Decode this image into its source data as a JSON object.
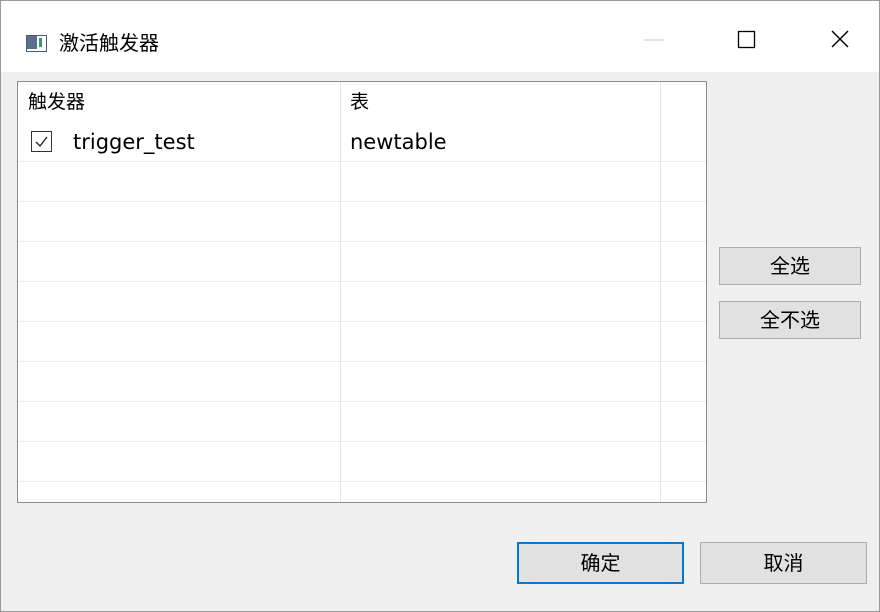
{
  "window": {
    "title": "激活触发器",
    "icons": {
      "app": "app-window-icon",
      "minimize": "minimize-icon",
      "maximize": "maximize-icon",
      "close": "close-icon"
    }
  },
  "table": {
    "columns": [
      "触发器",
      "表"
    ],
    "rows": [
      {
        "checked": true,
        "trigger": "trigger_test",
        "table": "newtable"
      }
    ]
  },
  "side_buttons": {
    "select_all": "全选",
    "select_none": "全不选"
  },
  "footer": {
    "ok": "确定",
    "cancel": "取消"
  },
  "colors": {
    "accent": "#0078d7",
    "button_bg": "#e1e1e1",
    "window_bg": "#f0f0f0"
  }
}
